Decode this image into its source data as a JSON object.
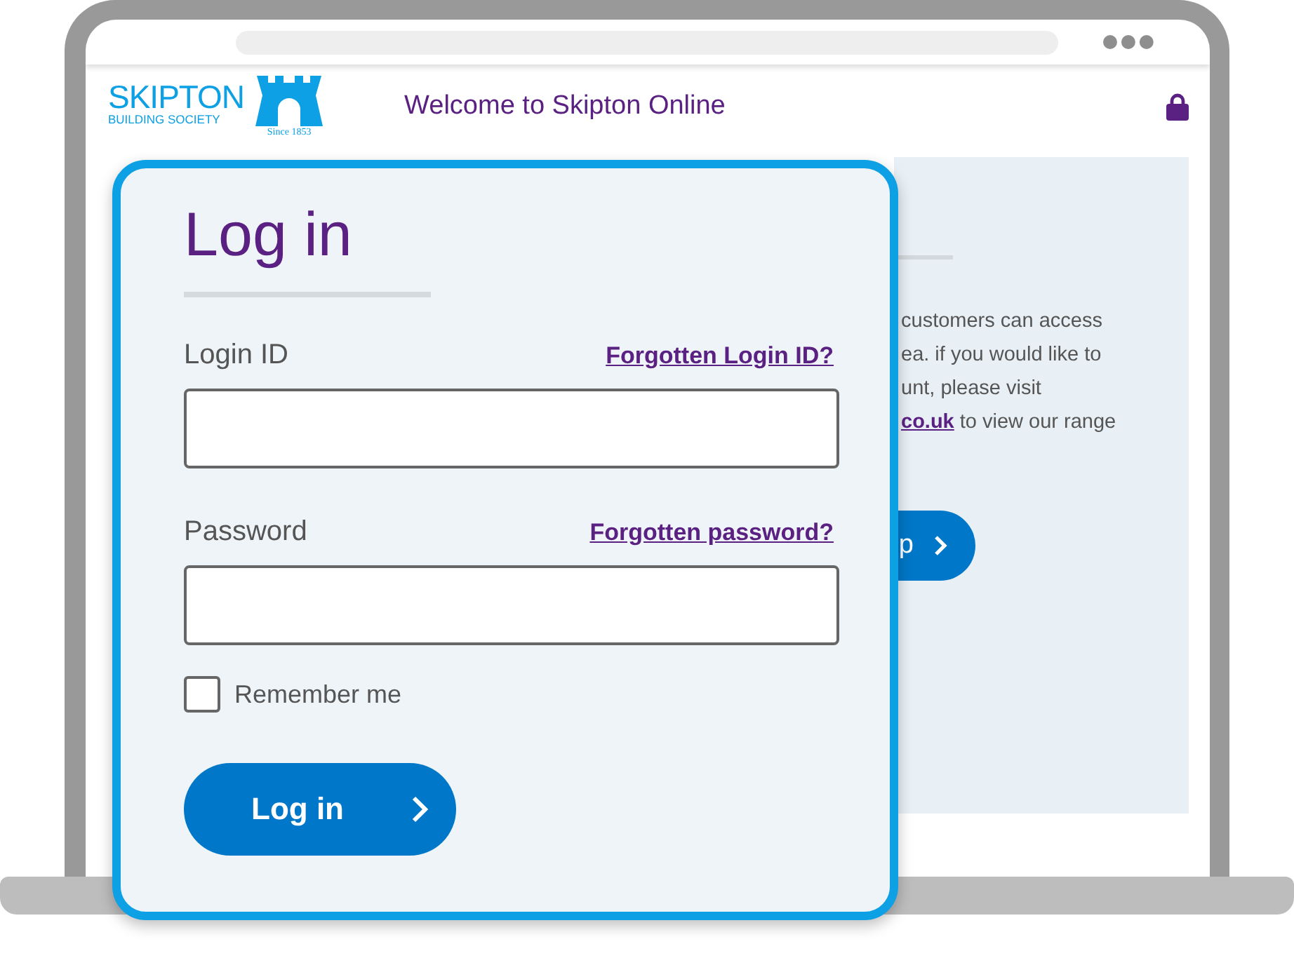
{
  "header": {
    "logo": {
      "name": "SKIPTON",
      "subtitle": "BUILDING SOCIETY",
      "since": "Since 1853"
    },
    "title": "Welcome to Skipton Online"
  },
  "background_panel": {
    "lines": [
      "customers can access",
      "ea. if you would like to",
      "unt, please visit"
    ],
    "link": "co.uk",
    "link_suffix": "to view our range",
    "button": "p"
  },
  "login": {
    "title": "Log in",
    "fields": [
      {
        "label": "Login ID",
        "link": "Forgotten Login ID?"
      },
      {
        "label": "Password",
        "link": "Forgotten password?"
      }
    ],
    "remember": {
      "label": "Remember me",
      "checked": false
    },
    "button": "Log in"
  }
}
